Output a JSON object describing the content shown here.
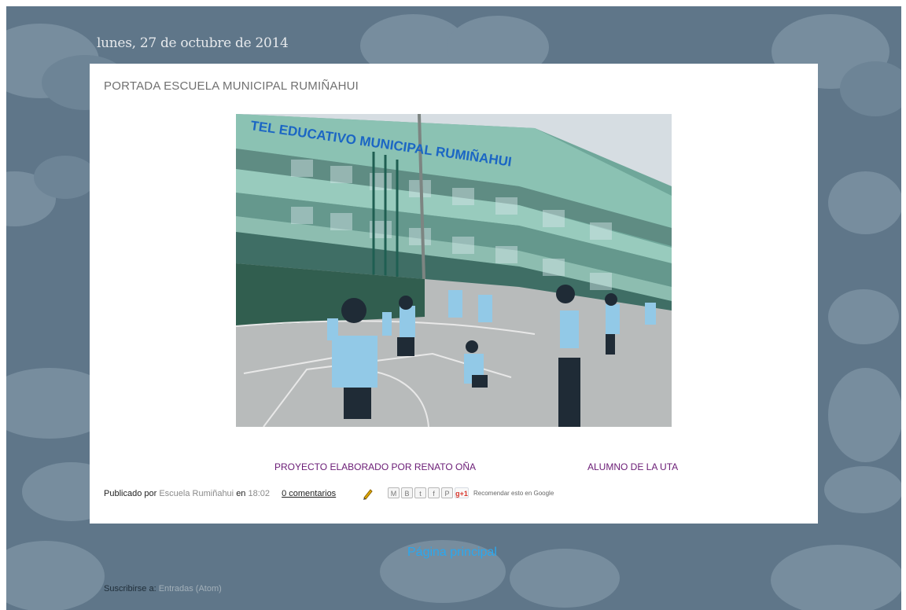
{
  "date_header": "lunes, 27 de octubre de 2014",
  "post": {
    "title": "PORTADA ESCUELA MUNICIPAL RUMIÑAHUI",
    "image_sign": "TEL EDUCATIVO MUNICIPAL RUMIÑAHUI",
    "caption_left": "PROYECTO ELABORADO POR RENATO OÑA",
    "caption_right": "ALUMNO DE LA UTA",
    "published_by_label": "Publicado por",
    "author": "Escuela Rumiñahui",
    "at_label": "en",
    "time": "18:02",
    "comments": "0 comentarios",
    "recommend": "Recomendar esto en Google",
    "share_buttons": [
      "M",
      "B",
      "t",
      "f",
      "P",
      "g+1"
    ]
  },
  "navigation": {
    "home_link": "Página principal"
  },
  "subscribe": {
    "label": "Suscribirse a:",
    "feed_link": "Entradas (Atom)"
  },
  "colors": {
    "background": "#5f7689",
    "card": "#ffffff",
    "caption": "#6a1b75",
    "home_link": "#2aa8ef"
  },
  "icons": {
    "edit": "pencil-icon",
    "email": "email-icon",
    "blog": "blogger-icon",
    "twitter": "twitter-icon",
    "facebook": "facebook-icon",
    "pinterest": "pinterest-icon",
    "google_plus": "google-plus-icon"
  }
}
